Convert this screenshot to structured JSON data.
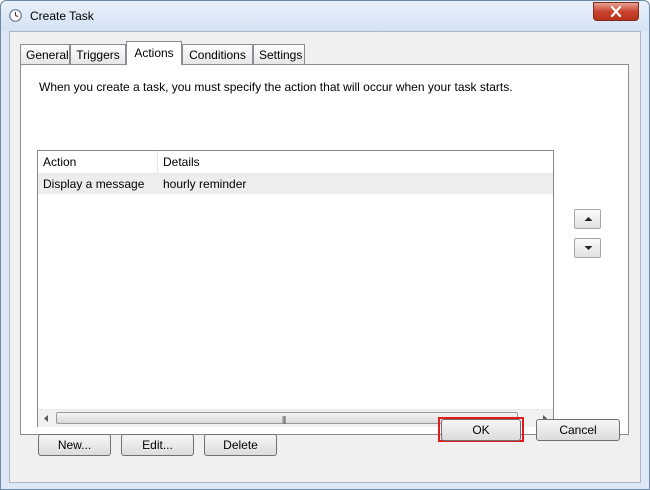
{
  "window": {
    "title": "Create Task"
  },
  "tabs": [
    {
      "label": "General"
    },
    {
      "label": "Triggers"
    },
    {
      "label": "Actions"
    },
    {
      "label": "Conditions"
    },
    {
      "label": "Settings"
    }
  ],
  "active_tab": "Actions",
  "actions_tab": {
    "instruction": "When you create a task, you must specify the action that will occur when your task starts.",
    "columns": [
      "Action",
      "Details"
    ],
    "rows": [
      {
        "action": "Display a message",
        "details": "hourly reminder"
      }
    ],
    "buttons": {
      "new": "New...",
      "edit": "Edit...",
      "delete": "Delete"
    }
  },
  "footer": {
    "ok": "OK",
    "cancel": "Cancel"
  },
  "colors": {
    "highlight": "#e21a1a",
    "selected_row": "#ededed"
  }
}
